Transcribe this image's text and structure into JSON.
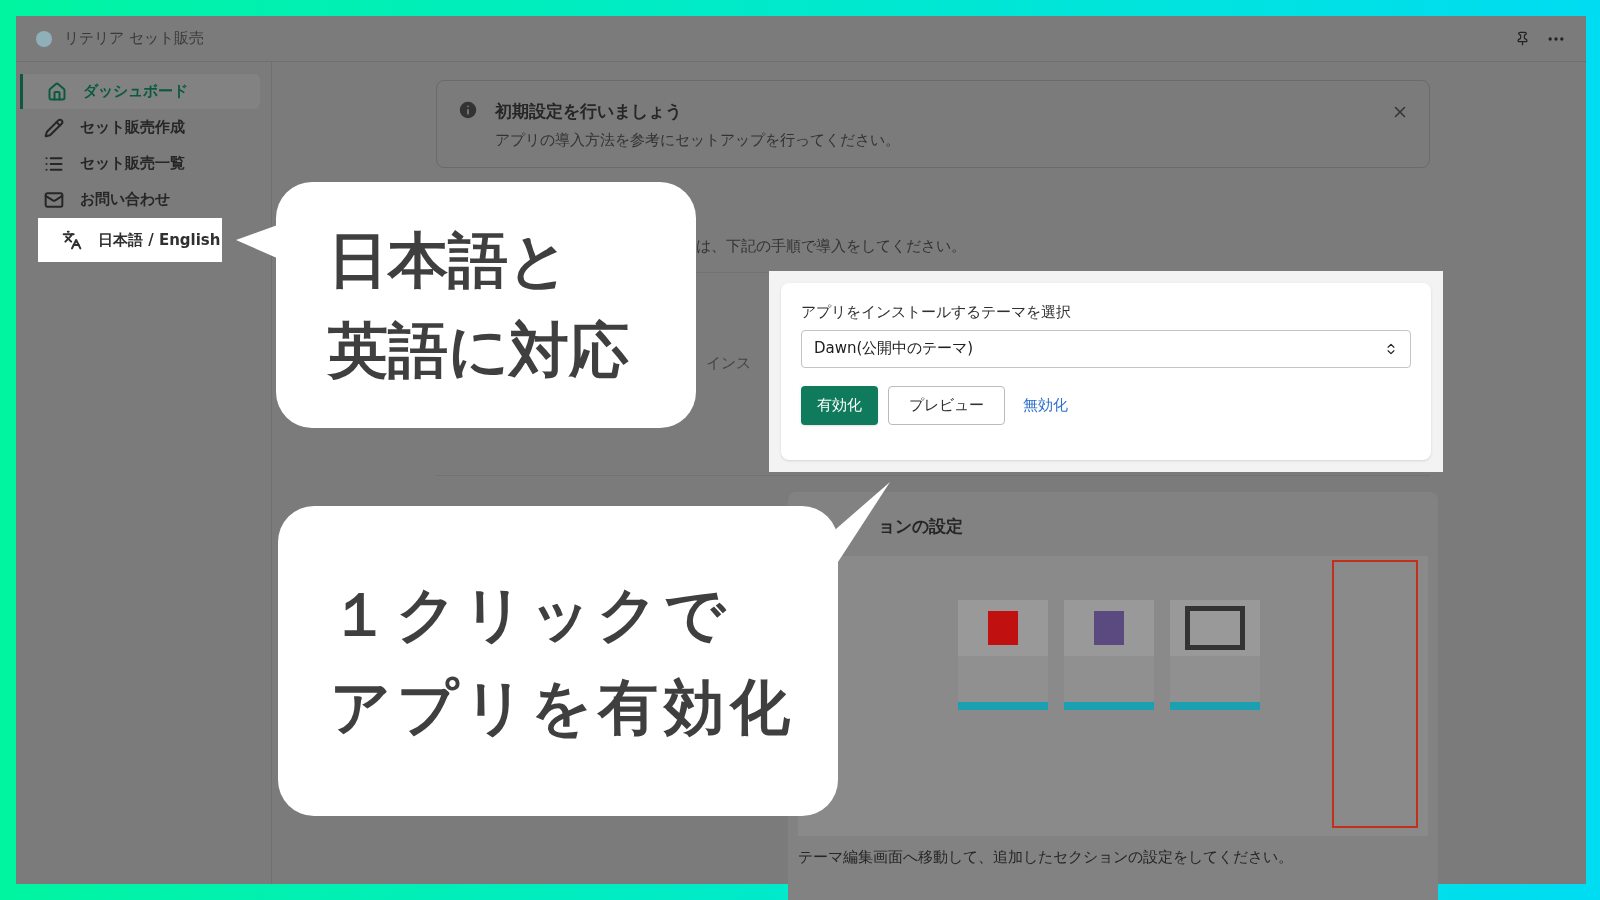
{
  "app": {
    "title": "リテリア セット販売"
  },
  "sidebar": {
    "items": [
      {
        "label": "ダッシュボード",
        "selected": true,
        "highlighted": false
      },
      {
        "label": "セット販売作成",
        "selected": false,
        "highlighted": false
      },
      {
        "label": "セット販売一覧",
        "selected": false,
        "highlighted": false
      },
      {
        "label": "お問い合わせ",
        "selected": false,
        "highlighted": false
      },
      {
        "label": "日本語 / English",
        "selected": false,
        "highlighted": true
      }
    ]
  },
  "banner": {
    "title": "初期設定を行いましょう",
    "text": "アプリの導入方法を参考にセットアップを行ってください。"
  },
  "intro_text": "は、下記の手順で導入をしてください。",
  "step_label": "インス",
  "theme_card": {
    "label": "アプリをインストールするテーマを選択",
    "select_value": "Dawn(公開中のテーマ)",
    "buttons": [
      {
        "label": "有効化",
        "kind": "primary"
      },
      {
        "label": "プレビュー",
        "kind": "secondary"
      },
      {
        "label": "無効化",
        "kind": "link"
      }
    ]
  },
  "section": {
    "heading": "ョンの設定",
    "footer": "テーマ編集画面へ移動して、追加したセクションの設定をしてください。"
  },
  "callouts": [
    {
      "lines": [
        "日本語と",
        "英語に対応"
      ]
    },
    {
      "lines": [
        "１クリックで",
        "アプリを有効化"
      ]
    }
  ]
}
